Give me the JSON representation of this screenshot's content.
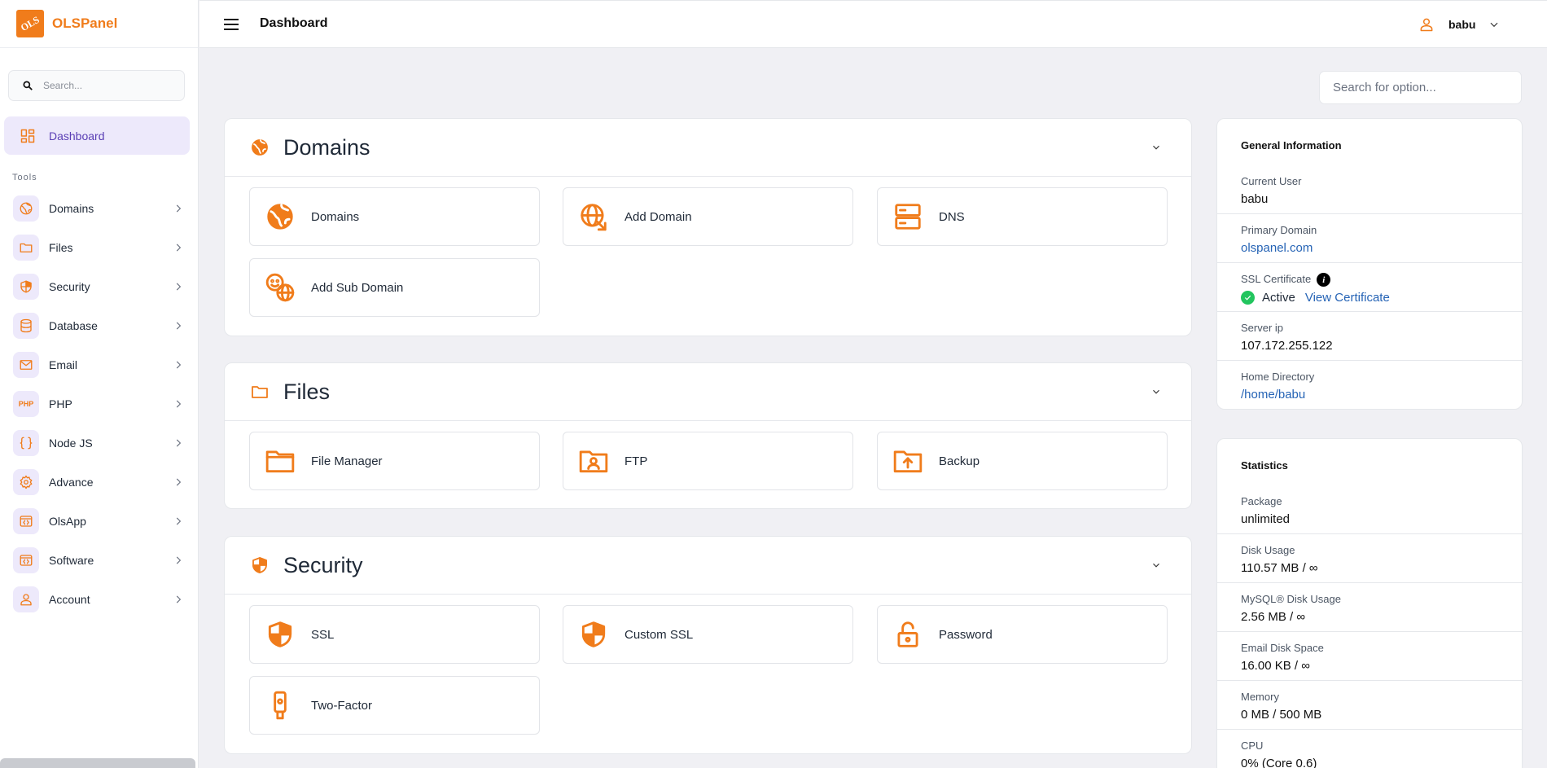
{
  "brand": {
    "logo_text": "OLS",
    "name": "OLSPanel"
  },
  "sidebar": {
    "search_placeholder": "Search...",
    "dashboard_label": "Dashboard",
    "tools_heading": "Tools",
    "items": [
      {
        "label": "Domains",
        "icon": "globe-icon"
      },
      {
        "label": "Files",
        "icon": "folder-icon"
      },
      {
        "label": "Security",
        "icon": "shield-icon"
      },
      {
        "label": "Database",
        "icon": "database-icon"
      },
      {
        "label": "Email",
        "icon": "mail-icon"
      },
      {
        "label": "PHP",
        "icon": "php-icon",
        "icon_text": "PHP"
      },
      {
        "label": "Node JS",
        "icon": "braces-icon"
      },
      {
        "label": "Advance",
        "icon": "gear-icon"
      },
      {
        "label": "OlsApp",
        "icon": "app-code-icon"
      },
      {
        "label": "Software",
        "icon": "software-code-icon"
      },
      {
        "label": "Account",
        "icon": "user-icon"
      }
    ]
  },
  "header": {
    "title": "Dashboard",
    "username": "babu"
  },
  "option_search": {
    "placeholder": "Search for option..."
  },
  "sections": {
    "domains": {
      "title": "Domains",
      "tiles": [
        "Domains",
        "Add Domain",
        "DNS",
        "Add Sub Domain"
      ]
    },
    "files": {
      "title": "Files",
      "tiles": [
        "File Manager",
        "FTP",
        "Backup"
      ]
    },
    "security": {
      "title": "Security",
      "tiles": [
        "SSL",
        "Custom SSL",
        "Password",
        "Two-Factor"
      ]
    }
  },
  "general_info": {
    "title": "General Information",
    "current_user_label": "Current User",
    "current_user": "babu",
    "primary_domain_label": "Primary Domain",
    "primary_domain": "olspanel.com",
    "ssl_label": "SSL Certificate",
    "ssl_info_glyph": "i",
    "ssl_status": "Active",
    "ssl_view": "View Certificate",
    "server_ip_label": "Server ip",
    "server_ip": "107.172.255.122",
    "home_dir_label": "Home Directory",
    "home_dir": "/home/babu"
  },
  "statistics": {
    "title": "Statistics",
    "rows": [
      {
        "label": "Package",
        "value": "unlimited"
      },
      {
        "label": "Disk Usage",
        "value": "110.57 MB / ∞"
      },
      {
        "label": "MySQL® Disk Usage",
        "value": "2.56 MB / ∞"
      },
      {
        "label": "Email Disk Space",
        "value": "16.00 KB / ∞"
      },
      {
        "label": "Memory",
        "value": "0 MB / 500 MB"
      },
      {
        "label": "CPU",
        "value": "0% (Core 0.6)"
      }
    ]
  },
  "colors": {
    "accent": "#f07c1b",
    "active_bg": "#ede9fb",
    "active_text": "#5b3fb5",
    "link": "#2563b5",
    "success": "#22c55e"
  }
}
